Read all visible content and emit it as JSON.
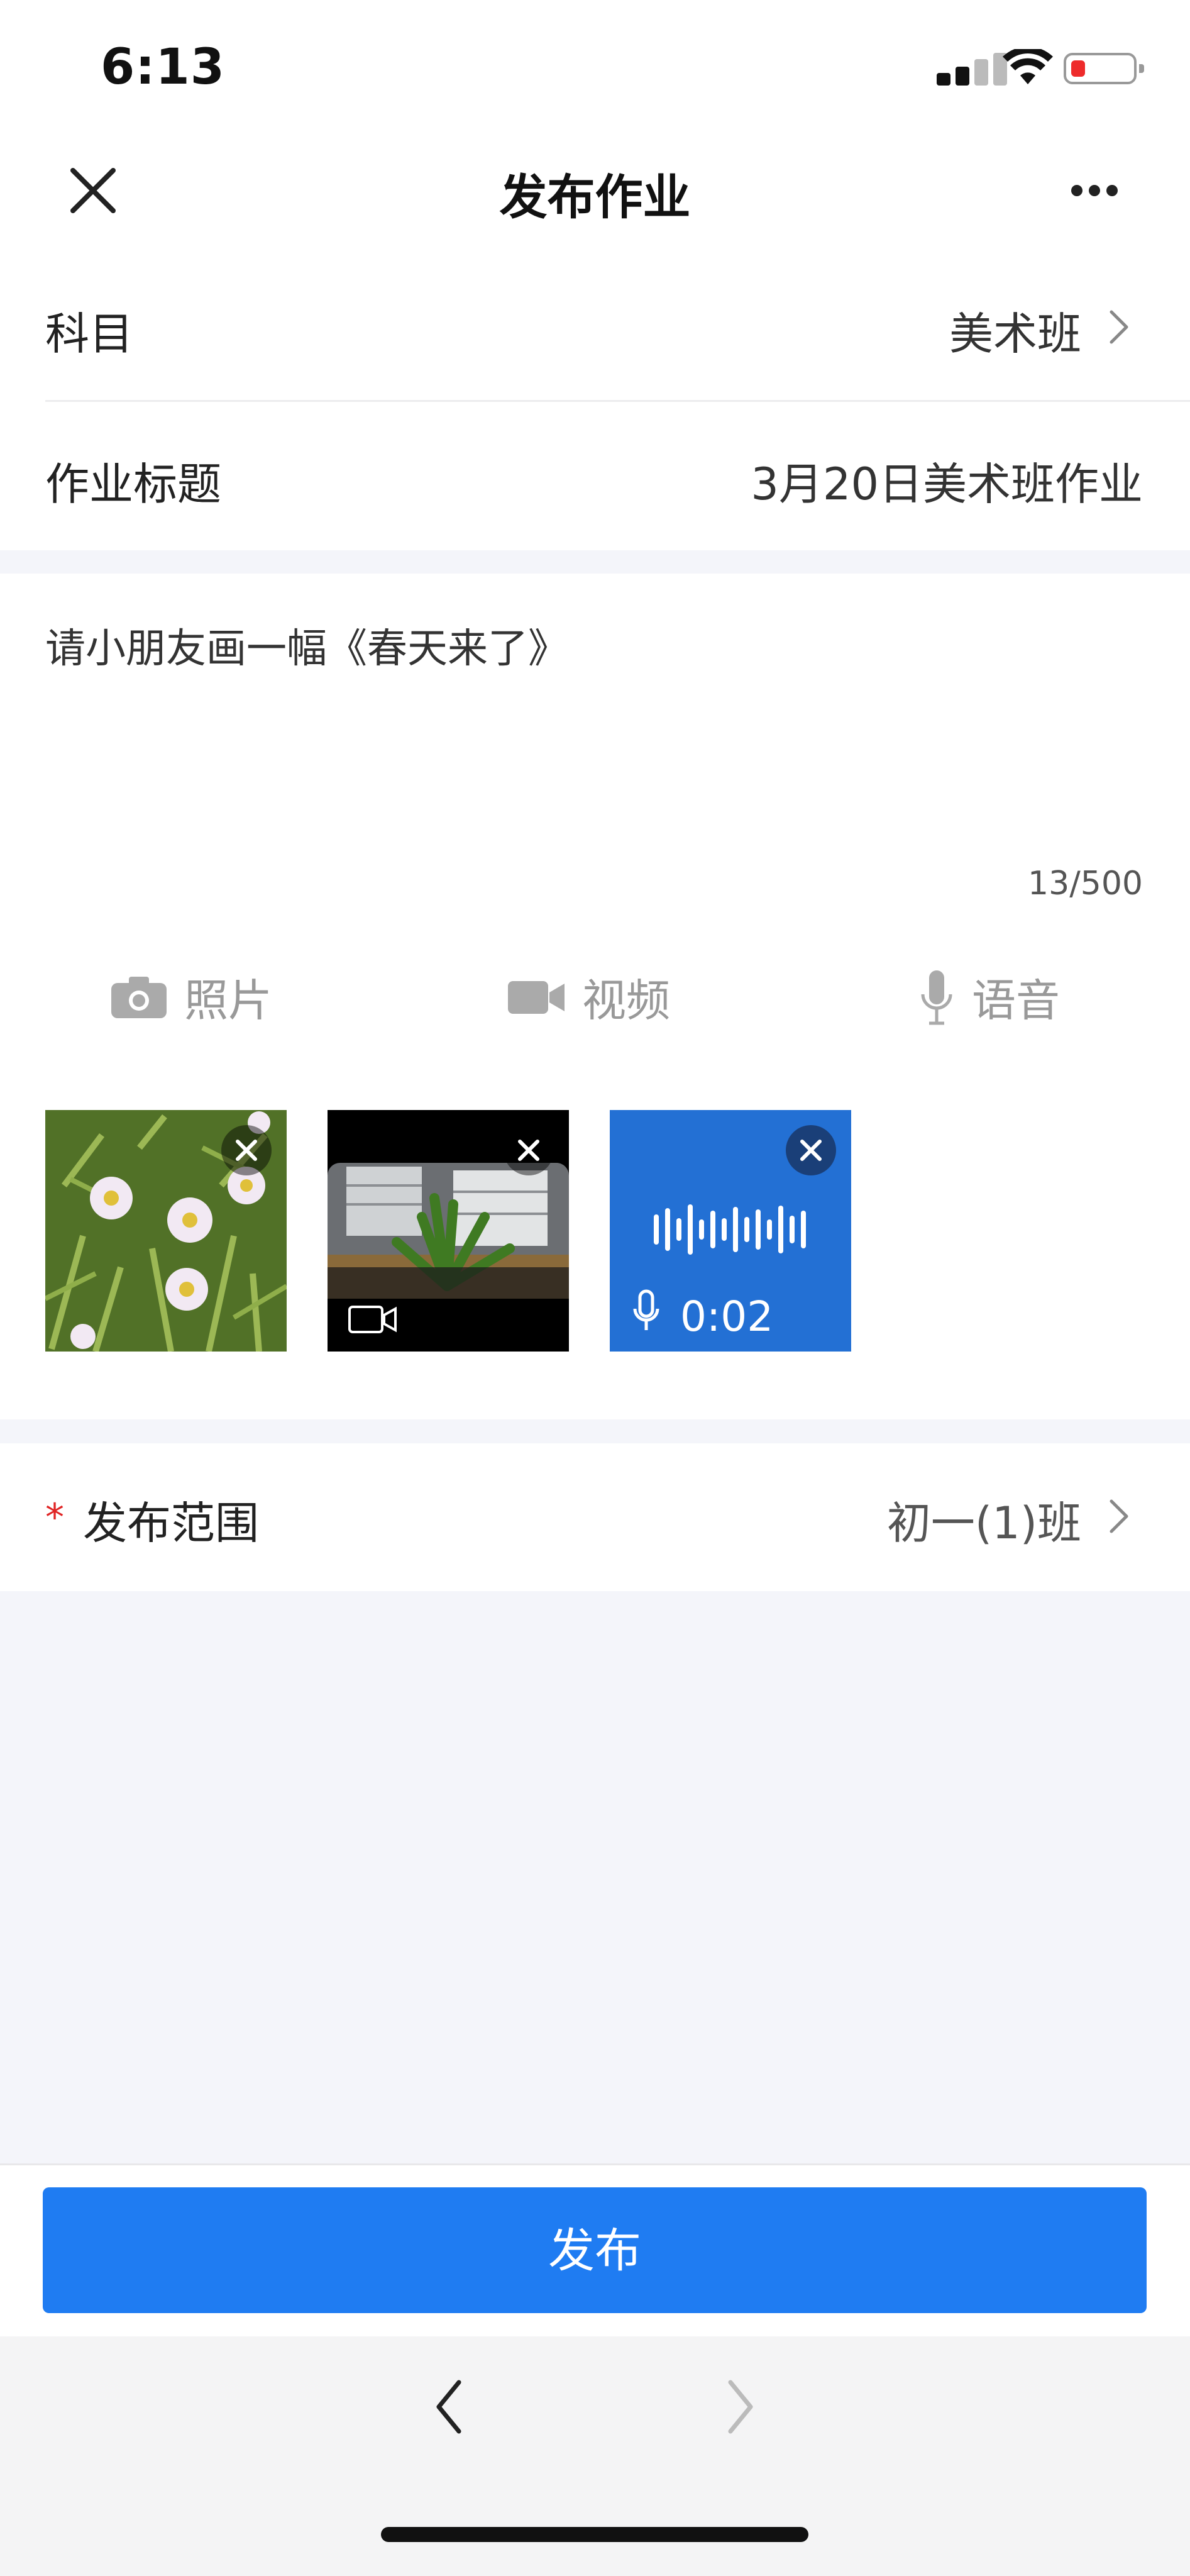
{
  "status_bar": {
    "time": "6:13"
  },
  "header": {
    "title": "发布作业"
  },
  "form": {
    "subject": {
      "label": "科目",
      "value": "美术班"
    },
    "homework_title": {
      "label": "作业标题",
      "value": "3月20日美术班作业"
    }
  },
  "content": {
    "text": "请小朋友画一幅《春天来了》",
    "counter": "13/500"
  },
  "attach_toolbar": {
    "photo_label": "照片",
    "video_label": "视频",
    "voice_label": "语音"
  },
  "attachments": {
    "voice_duration": "0:02"
  },
  "scope": {
    "required_mark": "*",
    "label": "发布范围",
    "value": "初一(1)班"
  },
  "publish_button": {
    "label": "发布"
  },
  "colors": {
    "accent": "#1f7cf2",
    "voice_tile": "#2370d4",
    "required": "#e02424"
  }
}
